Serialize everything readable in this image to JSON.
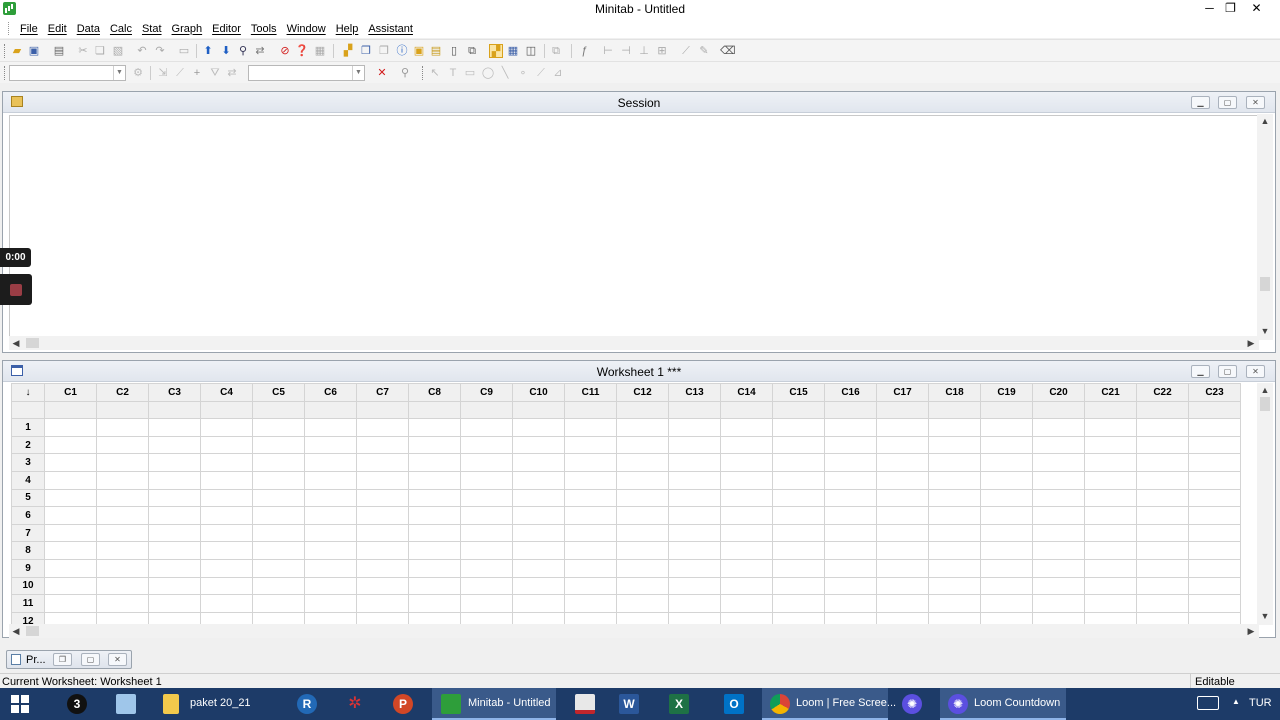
{
  "window": {
    "title": "Minitab - Untitled",
    "minimize_glyph": "─",
    "restore_glyph": "❐",
    "close_glyph": "✕"
  },
  "menu": [
    "File",
    "Edit",
    "Data",
    "Calc",
    "Stat",
    "Graph",
    "Editor",
    "Tools",
    "Window",
    "Help",
    "Assistant"
  ],
  "toolbar_icons": {
    "row1": [
      "open-icon",
      "save-icon",
      "print-icon",
      "cut-icon",
      "copy-icon",
      "paste-icon",
      "undo-icon",
      "redo-icon",
      "edit-last-dialog-icon",
      "previous-icon",
      "next-icon",
      "find-icon",
      "replace-icon",
      "cancel-icon",
      "help-icon",
      "stat-guide-icon",
      "show-graphs-icon",
      "tile-graphs-icon",
      "close-graphs-icon",
      "info-icon",
      "history-icon",
      "report-pad-icon",
      "new-worksheet-icon",
      "project-manager-icon",
      "session-window-icon",
      "data-window-icon",
      "related-documents-icon",
      "graph-icon",
      "formula-icon",
      "insert-cells-icon",
      "insert-rows-icon",
      "insert-columns-icon",
      "move-columns-icon",
      "brush-icon",
      "edit-icon",
      "eraser-icon"
    ],
    "row2": [
      "select-icon",
      "line-icon",
      "crosshair-icon",
      "filter-icon",
      "swap-icon",
      "delete-icon",
      "zoom-icon",
      "pointer-icon",
      "text-icon",
      "rectangle-icon",
      "ellipse-icon",
      "line-tool-icon",
      "marker-icon",
      "polyline-icon",
      "polygon-icon"
    ]
  },
  "session": {
    "title": "Session"
  },
  "worksheet": {
    "title": "Worksheet 1 ***",
    "corner": "↓",
    "columns": [
      "C1",
      "C2",
      "C3",
      "C4",
      "C5",
      "C6",
      "C7",
      "C8",
      "C9",
      "C10",
      "C11",
      "C12",
      "C13",
      "C14",
      "C15",
      "C16",
      "C17",
      "C18",
      "C19",
      "C20",
      "C21",
      "C22",
      "C23"
    ],
    "rows": [
      "1",
      "2",
      "3",
      "4",
      "5",
      "6",
      "7",
      "8",
      "9",
      "10",
      "11",
      "12"
    ]
  },
  "project_manager": {
    "label": "Pr..."
  },
  "statusbar": {
    "text": "Current Worksheet: Worksheet 1",
    "mode": "Editable"
  },
  "loom": {
    "timer": "0:00"
  },
  "taskbar": {
    "start_icon": "windows-icon",
    "apps": [
      {
        "name": "app-3",
        "label": "",
        "icon": "3"
      },
      {
        "name": "app-notepad",
        "label": "",
        "icon": ""
      },
      {
        "name": "app-explorer",
        "label": "paket 20_21",
        "icon": ""
      },
      {
        "name": "app-r",
        "label": "",
        "icon": "R"
      },
      {
        "name": "app-network",
        "label": "",
        "icon": "✲"
      },
      {
        "name": "app-powerpoint",
        "label": "",
        "icon": "P"
      },
      {
        "name": "app-minitab",
        "label": "Minitab - Untitled",
        "icon": ""
      },
      {
        "name": "app-red",
        "label": "",
        "icon": ""
      },
      {
        "name": "app-word",
        "label": "",
        "icon": "W"
      },
      {
        "name": "app-excel",
        "label": "",
        "icon": "X"
      },
      {
        "name": "app-outlook",
        "label": "",
        "icon": "O"
      },
      {
        "name": "app-chrome",
        "label": "Loom | Free Scree...",
        "icon": ""
      },
      {
        "name": "app-loom",
        "label": "",
        "icon": "✺"
      },
      {
        "name": "app-loom-countdown",
        "label": "Loom Countdown",
        "icon": "✺"
      }
    ],
    "tray": {
      "keyboard_icon": "keyboard-icon",
      "chevron": "▲",
      "language": "TUR"
    }
  },
  "colors": {
    "taskbar": "#1d3b68",
    "minitab_green": "#2e9e3a",
    "excel_green": "#1e7145",
    "word_blue": "#2b579a",
    "powerpoint_red": "#d24726",
    "outlook_blue": "#0072c6"
  }
}
